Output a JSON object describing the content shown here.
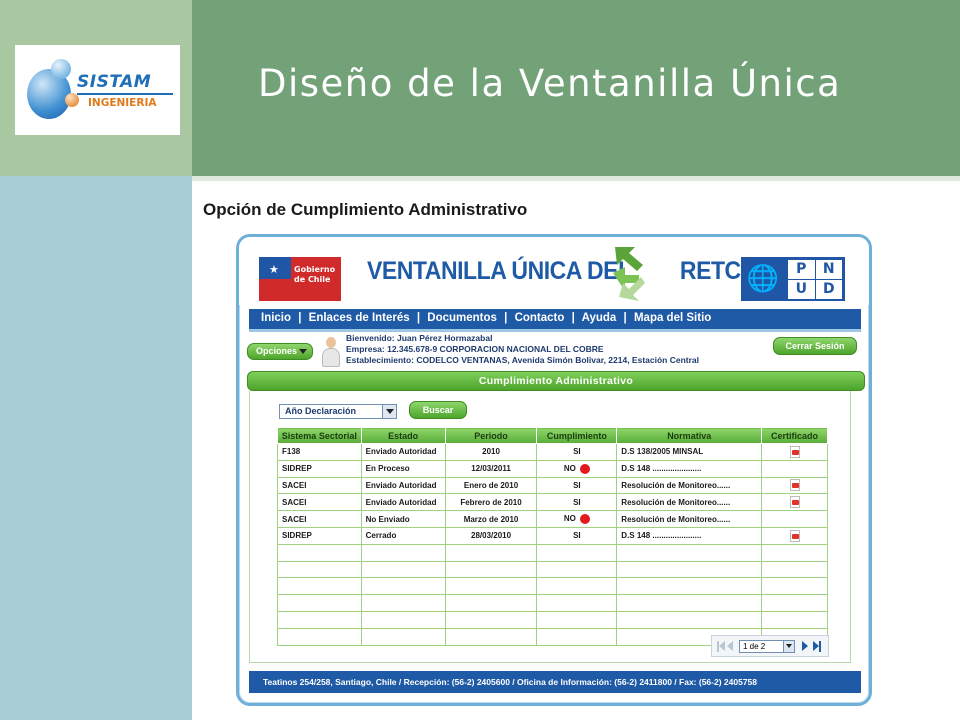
{
  "slide": {
    "title": "Diseño de la Ventanilla Única",
    "subtitle": "Opción de Cumplimiento Administrativo",
    "logo": {
      "line1": "SISTAM",
      "line2": "INGENIERIA"
    }
  },
  "colors": {
    "header_band": "#73a279",
    "left_top": "#a9c7a1",
    "left_bottom": "#a8cdd6",
    "site_blue": "#1f5aa6",
    "site_green": "#58ad36"
  },
  "site": {
    "gob_label": "Gobierno de Chile",
    "brand_blue1": "VENTANILLA ÚNICA DEL",
    "brand_blue2": "RETC",
    "pnud_letters": [
      "P",
      "N",
      "U",
      "D"
    ],
    "nav": [
      "Inicio",
      "|",
      "Enlaces de Interés",
      "|",
      "Documentos",
      "|",
      "Contacto",
      "|",
      "Ayuda",
      "|",
      "Mapa del Sitio"
    ],
    "options_button": "Opciones",
    "user": {
      "welcome": "Bienvenido: Juan Pérez Hormazabal",
      "company": "Empresa: 12.345.678-9 CORPORACION NACIONAL DEL COBRE",
      "establishment": "Establecimiento: CODELCO VENTANAS, Avenida Simón Bolivar, 2214, Estación Central"
    },
    "logout_button": "Cerrar Sesión",
    "section_title": "Cumplimiento Administrativo",
    "filter_select": "Año Declaración",
    "search_button": "Buscar",
    "table": {
      "headers": [
        "Sistema Sectorial",
        "Estado",
        "Periodo",
        "Cumplimiento",
        "Normativa",
        "Certificado"
      ],
      "rows": [
        {
          "sistema": "F138",
          "estado": "Enviado Autoridad",
          "periodo": "2010",
          "cumplimiento": "SI",
          "flag": false,
          "normativa": "D.S 138/2005 MINSAL",
          "certificado": true
        },
        {
          "sistema": "SIDREP",
          "estado": "En Proceso",
          "periodo": "12/03/2011",
          "cumplimiento": "NO",
          "flag": true,
          "normativa": "D.S 148 ......................",
          "certificado": false
        },
        {
          "sistema": "SACEI",
          "estado": "Enviado Autoridad",
          "periodo": "Enero de 2010",
          "cumplimiento": "SI",
          "flag": false,
          "normativa": "Resolución de Monitoreo......",
          "certificado": true
        },
        {
          "sistema": "SACEI",
          "estado": "Enviado Autoridad",
          "periodo": "Febrero de 2010",
          "cumplimiento": "SI",
          "flag": false,
          "normativa": "Resolución de Monitoreo......",
          "certificado": true
        },
        {
          "sistema": "SACEI",
          "estado": "No Enviado",
          "periodo": "Marzo de 2010",
          "cumplimiento": "NO",
          "flag": true,
          "normativa": "Resolución de Monitoreo......",
          "certificado": false
        },
        {
          "sistema": "SIDREP",
          "estado": "Cerrado",
          "periodo": "28/03/2010",
          "cumplimiento": "SI",
          "flag": false,
          "normativa": "D.S 148 ......................",
          "certificado": true
        }
      ],
      "empty_rows": 6
    },
    "pager": {
      "page_select": "1 de 2"
    },
    "footer": "Teatinos 254/258, Santiago, Chile / Recepción: (56-2) 2405600 / Oficina de Información: (56-2) 2411800 / Fax: (56-2) 2405758"
  }
}
